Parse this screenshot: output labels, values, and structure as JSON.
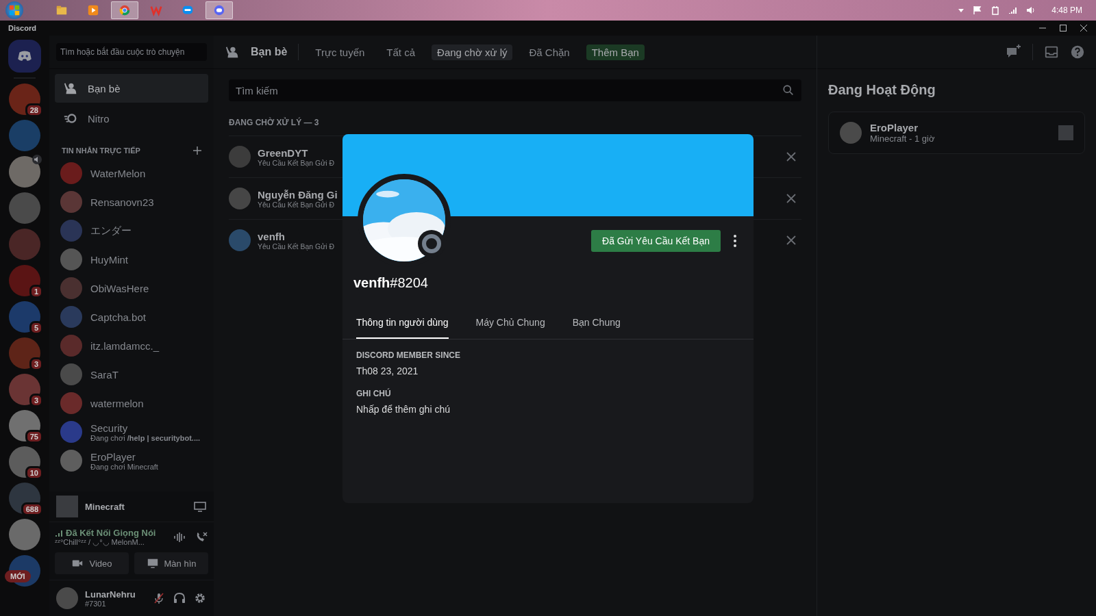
{
  "taskbar": {
    "apps": [
      {
        "kind": "folder",
        "active": false
      },
      {
        "kind": "player",
        "active": false
      },
      {
        "kind": "browser",
        "active": true
      },
      {
        "kind": "office",
        "active": false
      },
      {
        "kind": "chat",
        "active": false
      },
      {
        "kind": "discord",
        "active": true
      }
    ],
    "clock": "4:48 PM"
  },
  "window": {
    "title": "Discord"
  },
  "servers": [
    {
      "color": "#6a2418",
      "badge": "28"
    },
    {
      "color": "#1a3e66"
    },
    {
      "color": "#6e6a66",
      "voice": true
    },
    {
      "color": "#4a4a4a"
    },
    {
      "color": "#4a2626"
    },
    {
      "color": "#5a1414",
      "badge": "1"
    },
    {
      "color": "#1c3a6a",
      "badge": "5"
    },
    {
      "color": "#5e2418",
      "badge": "3"
    },
    {
      "color": "#6a3434",
      "badge": "3"
    },
    {
      "color": "#707070",
      "badge": "75"
    },
    {
      "color": "#5c5c5c",
      "badge": "10"
    },
    {
      "color": "#2e3640",
      "badge": "688"
    },
    {
      "color": "#6a6a6a"
    },
    {
      "color": "#1c3a66",
      "new_label": "MỚI"
    }
  ],
  "sidebar": {
    "search": {
      "placeholder": "Tìm hoặc bắt đầu cuộc trò chuyện"
    },
    "nav": [
      {
        "kind": "friends",
        "label": "Bạn bè",
        "selected": true
      },
      {
        "kind": "nitro",
        "label": "Nitro",
        "selected": false
      }
    ],
    "dm_header": "TIN NHẮN TRỰC TIẾP",
    "dms": [
      {
        "name": "WaterMelon",
        "color": "#6a1c1c"
      },
      {
        "name": "Rensanovn23",
        "color": "#5a3636"
      },
      {
        "name": "エンダー",
        "color": "#2a3456"
      },
      {
        "name": "HuyMint",
        "color": "#555555"
      },
      {
        "name": "ObiWasHere",
        "color": "#4a3030"
      },
      {
        "name": "Captcha.bot",
        "color": "#2a3a5c"
      },
      {
        "name": "itz.lamdamcc._",
        "color": "#5a2a2a"
      },
      {
        "name": "SaraT",
        "color": "#4a4a4a"
      },
      {
        "name": "watermelon",
        "color": "#6a2a2a"
      },
      {
        "name": "Security",
        "color": "#2a3a8a",
        "status": "Đang chơi **/help | securitybot....**"
      },
      {
        "name": "EroPlayer",
        "color": "#5e5e5e",
        "status": "Đang chơi Minecraft"
      }
    ]
  },
  "activity": {
    "game": "Minecraft"
  },
  "voice": {
    "status": "Đã Kết Nối Giọng Nói",
    "channel": "ᶻᶻ°Chill°ᶻᶻ / ◡°◡ MelonM..."
  },
  "media_buttons": [
    {
      "kind": "camera",
      "label": "Video"
    },
    {
      "kind": "screen",
      "label": "Màn hìn"
    }
  ],
  "user": {
    "name": "LunarNehru",
    "tag": "#7301"
  },
  "header": {
    "title": "Bạn bè",
    "tabs": [
      {
        "kind": "tab",
        "label": "Trực tuyến",
        "selected": false
      },
      {
        "kind": "tab",
        "label": "Tất cả",
        "selected": false
      },
      {
        "kind": "tab",
        "label": "Đang chờ xử lý",
        "selected": true
      },
      {
        "kind": "tab",
        "label": "Đã Chặn",
        "selected": false
      },
      {
        "kind": "add",
        "label": "Thêm Bạn",
        "selected": false
      }
    ]
  },
  "search": {
    "placeholder": "Tìm kiếm"
  },
  "pending": {
    "header": "ĐANG CHỜ XỬ LÝ — 3",
    "rows": [
      {
        "name": "GreenDYT",
        "note": "Yêu Cầu Kết Bạn Gửi Đ",
        "color": "#3c3c3c"
      },
      {
        "name": "Nguyễn Đăng Gi",
        "note": "Yêu Cầu Kết Bạn Gửi Đ",
        "color": "#464646"
      },
      {
        "name": "venfh",
        "note": "Yêu Cầu Kết Bạn Gửi Đ",
        "color": "#2a4a6a"
      }
    ]
  },
  "active_now": {
    "title": "Đang Hoạt Động",
    "cards": [
      {
        "name": "EroPlayer",
        "detail": "Minecraft - 1 giờ"
      }
    ]
  },
  "profile": {
    "name": "venfh",
    "tag": "#8204",
    "action": "Đã Gửi Yêu Cầu Kết Bạn",
    "tabs": [
      {
        "label": "Thông tin người dùng",
        "selected": true
      },
      {
        "label": "Máy Chủ Chung",
        "selected": false
      },
      {
        "label": "Bạn Chung",
        "selected": false
      }
    ],
    "sections": [
      {
        "title": "DISCORD MEMBER SINCE",
        "text": "Th08 23, 2021"
      }
    ],
    "note": {
      "title": "GHI CHÚ",
      "placeholder": "Nhấp để thêm ghi chú"
    }
  }
}
